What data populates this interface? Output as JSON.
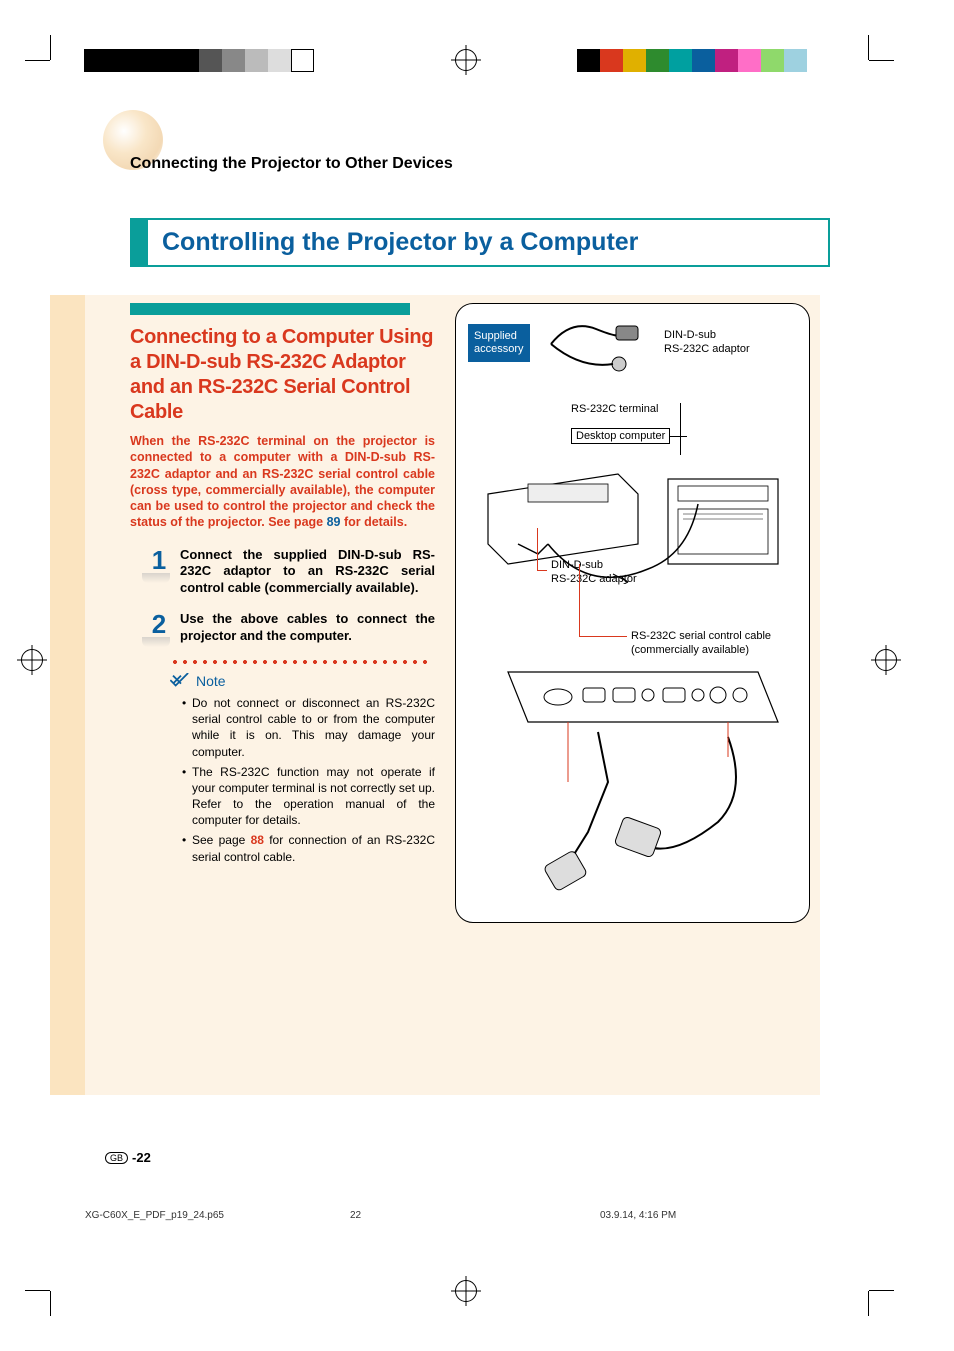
{
  "header": {
    "breadcrumb": "Connecting the Projector to Other Devices",
    "title": "Controlling the Projector by a Computer"
  },
  "section": {
    "heading": "Connecting to a Computer Using a DIN-D-sub RS-232C Adaptor and an RS-232C Serial Control Cable",
    "intro_pre": "When the RS-232C terminal on the projector is connected to a computer with a DIN-D-sub RS-232C adaptor and an RS-232C serial control cable (cross type, commercially available), the computer can be used to control the projector and check the status of the projector. See page ",
    "intro_ref": "89",
    "intro_post": " for details."
  },
  "steps": [
    {
      "num": "1",
      "text": "Connect the supplied DIN-D-sub RS-232C adaptor to an RS-232C serial control cable (commercially available)."
    },
    {
      "num": "2",
      "text": "Use the above cables to connect the projector and the computer."
    }
  ],
  "note": {
    "label": "Note",
    "bullets": [
      {
        "t": "Do not connect or disconnect an RS-232C serial control cable to or from the computer while it is on. This may damage your computer."
      },
      {
        "t": "The RS-232C function may not operate if your computer terminal is not correctly set up. Refer to the operation manual of the computer for details."
      },
      {
        "pre": "See page ",
        "ref": "88",
        "post": " for connection of an RS-232C serial control cable."
      }
    ]
  },
  "diagram": {
    "supplied_l1": "Supplied",
    "supplied_l2": "accessory",
    "label_adaptor": "DIN-D-sub\nRS-232C adaptor",
    "label_terminal": "RS-232C terminal",
    "label_desktop": "Desktop computer",
    "label_adaptor2": "DIN-D-sub\nRS-232C adaptor",
    "label_cable": "RS-232C serial control cable\n(commercially available)"
  },
  "footer": {
    "gb": "GB",
    "page_num": "-22",
    "file": "XG-C60X_E_PDF_p19_24.p65",
    "sheet": "22",
    "timestamp": "03.9.14, 4:16 PM"
  },
  "colorbars": {
    "left": [
      "#000",
      "#000",
      "#000",
      "#000",
      "#000",
      "#555",
      "#888",
      "#bbb",
      "#ddd",
      "#fff"
    ],
    "right": [
      "#000",
      "#d9381e",
      "#e0b000",
      "#2e8b2e",
      "#00a0a0",
      "#0a5f9e",
      "#c02080",
      "#ff6ec7",
      "#8fd96b",
      "#9ed1e0"
    ]
  }
}
